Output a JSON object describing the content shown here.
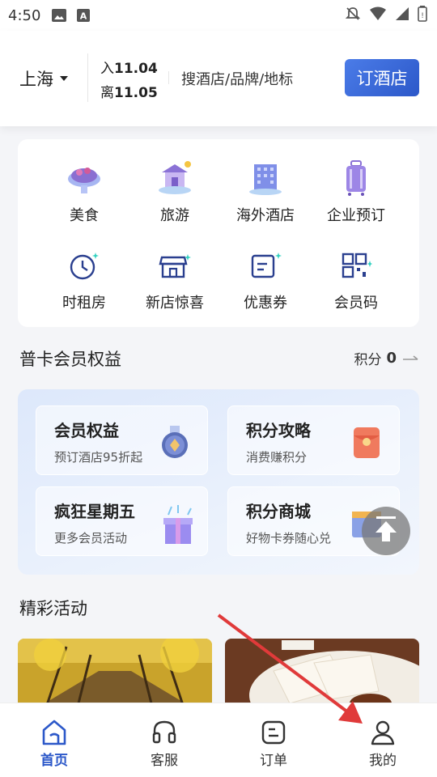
{
  "status": {
    "time": "4:50"
  },
  "header": {
    "city": "上海",
    "checkin_label": "入",
    "checkin_date": "11.04",
    "checkout_label": "离",
    "checkout_date": "11.05",
    "search_placeholder": "搜酒店/品牌/地标",
    "book_button": "订酒店"
  },
  "quick_grid": [
    {
      "label": "美食",
      "icon": "food-icon"
    },
    {
      "label": "旅游",
      "icon": "travel-icon"
    },
    {
      "label": "海外酒店",
      "icon": "overseas-hotel-icon"
    },
    {
      "label": "企业预订",
      "icon": "luggage-icon"
    },
    {
      "label": "时租房",
      "icon": "clock-icon"
    },
    {
      "label": "新店惊喜",
      "icon": "store-icon"
    },
    {
      "label": "优惠券",
      "icon": "coupon-icon"
    },
    {
      "label": "会员码",
      "icon": "qr-code-icon"
    }
  ],
  "member": {
    "title": "普卡会员权益",
    "points_label": "积分",
    "points_value": "0",
    "cards": [
      {
        "title": "会员权益",
        "subtitle": "预订酒店95折起",
        "icon": "medal-icon"
      },
      {
        "title": "积分攻略",
        "subtitle": "消费赚积分",
        "icon": "red-envelope-icon"
      },
      {
        "title": "疯狂星期五",
        "subtitle": "更多会员活动",
        "icon": "gift-box-icon"
      },
      {
        "title": "积分商城",
        "subtitle": "好物卡券随心兑",
        "icon": "shop-icon"
      }
    ]
  },
  "activities": {
    "title": "精彩活动"
  },
  "bottom_nav": [
    {
      "label": "首页",
      "icon": "home-icon",
      "active": true
    },
    {
      "label": "客服",
      "icon": "headset-icon",
      "active": false
    },
    {
      "label": "订单",
      "icon": "order-icon",
      "active": false
    },
    {
      "label": "我的",
      "icon": "profile-icon",
      "active": false
    }
  ],
  "colors": {
    "accent": "#2c58c9",
    "annotation_arrow": "#e03a3a"
  }
}
